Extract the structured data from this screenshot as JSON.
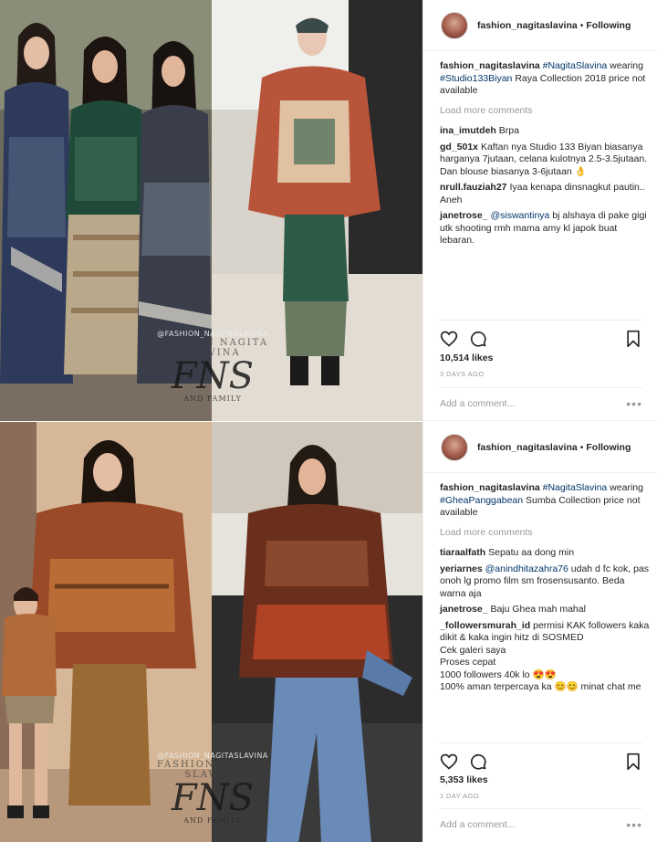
{
  "posts": [
    {
      "user": "fashion_nagitaslavina",
      "follow_label": "Following",
      "caption": {
        "user": "fashion_nagitaslavina",
        "tag1": "#NagitaSlavina",
        "text1": " wearing ",
        "tag2": "#Studio133Biyan",
        "text2": " Raya Collection 2018 price not available"
      },
      "load_more": "Load more comments",
      "comments": [
        {
          "user": "ina_imutdeh",
          "text": "Brpa"
        },
        {
          "user": "gd_501x",
          "text": "Kaftan nya Studio 133 Biyan biasanya harganya 7jutaan, celana kulotnya 2.5-3.5jutaan. Dan blouse biasanya 3-6jutaan 👌"
        },
        {
          "user": "nrull.fauziah27",
          "text": "Iyaa kenapa dinsnagkut pautin.. Aneh"
        },
        {
          "user": "janetrose_",
          "mention": "@siswantinya",
          "text": " bj alshaya di pake gigi utk shooting rmh mama amy kl japok buat lebaran."
        }
      ],
      "likes": "10,514 likes",
      "time": "3 DAYS AGO",
      "add_comment": "Add a comment...",
      "more": "•••",
      "watermark": {
        "handle": "@FASHION_NAGITASLAVINA",
        "name": "FASHION NAGITA SLAVINA",
        "logo": "FNS",
        "sub": "AND FAMILY"
      }
    },
    {
      "user": "fashion_nagitaslavina",
      "follow_label": "Following",
      "caption": {
        "user": "fashion_nagitaslavina",
        "tag1": "#NagitaSlavina",
        "text1": " wearing ",
        "tag2": "#GheaPanggabean",
        "text2": " Sumba Collection price not available"
      },
      "load_more": "Load more comments",
      "comments": [
        {
          "user": "tiaraalfath",
          "text": "Sepatu aa dong min"
        },
        {
          "user": "yeriarnes",
          "mention": "@anindhitazahra76",
          "text": " udah d fc kok, pas onoh lg promo film sm frosensusanto. Beda warna aja"
        },
        {
          "user": "janetrose_",
          "text": "Baju Ghea mah mahal"
        },
        {
          "user": "_followersmurah_id",
          "text": "permisi KAK followers kaka dikit & kaka ingin hitz di SOSMED\nCek galeri saya\nProses cepat\n1000 followers 40k lo 😍😍\n100% aman terpercaya ka 😊😊 minat chat me"
        }
      ],
      "likes": "5,353 likes",
      "time": "1 DAY AGO",
      "add_comment": "Add a comment...",
      "more": "•••",
      "watermark": {
        "handle": "@FASHION_NAGITASLAVINA",
        "name": "FASHION NAGITA SLAVINA",
        "logo": "FNS",
        "sub": "AND FAMILY"
      }
    }
  ],
  "colors": {
    "text": "#262626",
    "muted": "#999999",
    "link": "#003569",
    "border": "#efefef"
  }
}
